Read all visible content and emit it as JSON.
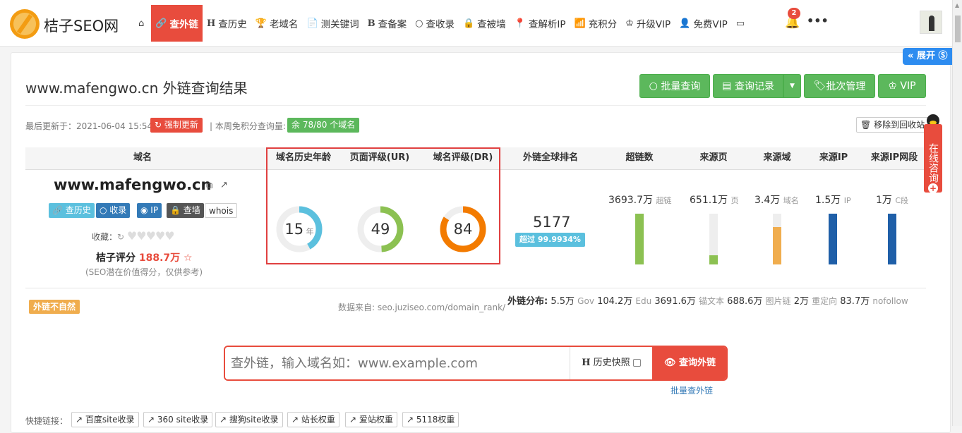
{
  "nav": {
    "brand": "桔子SEO网",
    "home_icon": "home-icon",
    "items": [
      {
        "icon": "🔗",
        "label": "查外链"
      },
      {
        "icon": "H",
        "label": "查历史"
      },
      {
        "icon": "🏆",
        "label": "老域名"
      },
      {
        "icon": "📄",
        "label": "测关键词"
      },
      {
        "icon": "B",
        "label": "查备案"
      },
      {
        "icon": "○",
        "label": "查收录"
      },
      {
        "icon": "🔒",
        "label": "查被墙"
      },
      {
        "icon": "📍",
        "label": "查解析IP"
      },
      {
        "icon": "📶",
        "label": "充积分"
      },
      {
        "icon": "♔",
        "label": "升级VIP"
      },
      {
        "icon": "👤",
        "label": "免费VIP"
      }
    ],
    "notification_count": "2",
    "more": "•••"
  },
  "page": {
    "title": "www.mafengwo.cn 外链查询结果",
    "buttons": {
      "batch_query": "批量查询",
      "query_record": "查询记录",
      "batch_manage": "批次管理",
      "vip": "VIP"
    },
    "last_update_label": "最后更新于：2021-06-04 15:54",
    "force_update": "强制更新",
    "weekly_quota_label": "| 本周免积分查询量:",
    "weekly_quota_value": "余 78/80 个域名",
    "move_to_recycle": "移除到回收站"
  },
  "table": {
    "headers": [
      "域名",
      "域名历史年龄",
      "页面评级(UR)",
      "域名评级(DR)",
      "外链全球排名",
      "超链数",
      "来源页",
      "来源域",
      "来源IP",
      "来源IP网段"
    ]
  },
  "domain": {
    "name": "www.mafengwo.cn",
    "buttons": [
      "查历史",
      "收录",
      "IP",
      "查墙",
      "whois"
    ],
    "collect_label": "收藏：",
    "score_label": "桔子评分",
    "score_value": "188.7万",
    "score_note": "(SEO潜在价值得分，仅供参考)"
  },
  "metrics": {
    "age": {
      "value": "15",
      "unit": "年",
      "fraction": 0.42,
      "color": "#5bc0de"
    },
    "ur": {
      "value": "49",
      "fraction": 0.49,
      "color": "#8cc152"
    },
    "dr": {
      "value": "84",
      "fraction": 0.84,
      "color": "#f37b00"
    },
    "rank": "5177",
    "rank_tag": "超过 99.9934%"
  },
  "stats": [
    {
      "value": "3693.7万",
      "unit": "超链",
      "fill": 1.0,
      "color": "#8cc152"
    },
    {
      "value": "651.1万",
      "unit": "页",
      "fill": 0.18,
      "color": "#8cc152"
    },
    {
      "value": "3.4万",
      "unit": "域名",
      "fill": 0.73,
      "color": "#f0ad4e"
    },
    {
      "value": "1.5万",
      "unit": "IP",
      "fill": 1.0,
      "color": "#1f5fa8"
    },
    {
      "value": "1万",
      "unit": "C段",
      "fill": 1.0,
      "color": "#1f5fa8"
    }
  ],
  "footer": {
    "unnatural": "外链不自然",
    "source": "数据来自: seo.juziseo.com/domain_rank/",
    "distribution_label": "外链分布:",
    "distribution": [
      {
        "value": "5.5万",
        "unit": "Gov"
      },
      {
        "value": "104.2万",
        "unit": "Edu"
      },
      {
        "value": "3691.6万",
        "unit": "锚文本"
      },
      {
        "value": "688.6万",
        "unit": "图片链"
      },
      {
        "value": "2万",
        "unit": "重定向"
      },
      {
        "value": "83.7万",
        "unit": "nofollow"
      }
    ]
  },
  "search": {
    "placeholder": "查外链，输入域名如：www.example.com",
    "history_label": "历史快照",
    "submit": "查询外链",
    "batch_link": "批量查外链"
  },
  "quick": {
    "label": "快捷链接：",
    "links": [
      "百度site收录",
      "360 site收录",
      "搜狗site收录",
      "站长权重",
      "爱站权重",
      "5118权重"
    ]
  },
  "side": {
    "expand": "展开",
    "consult": "在线咨询"
  }
}
